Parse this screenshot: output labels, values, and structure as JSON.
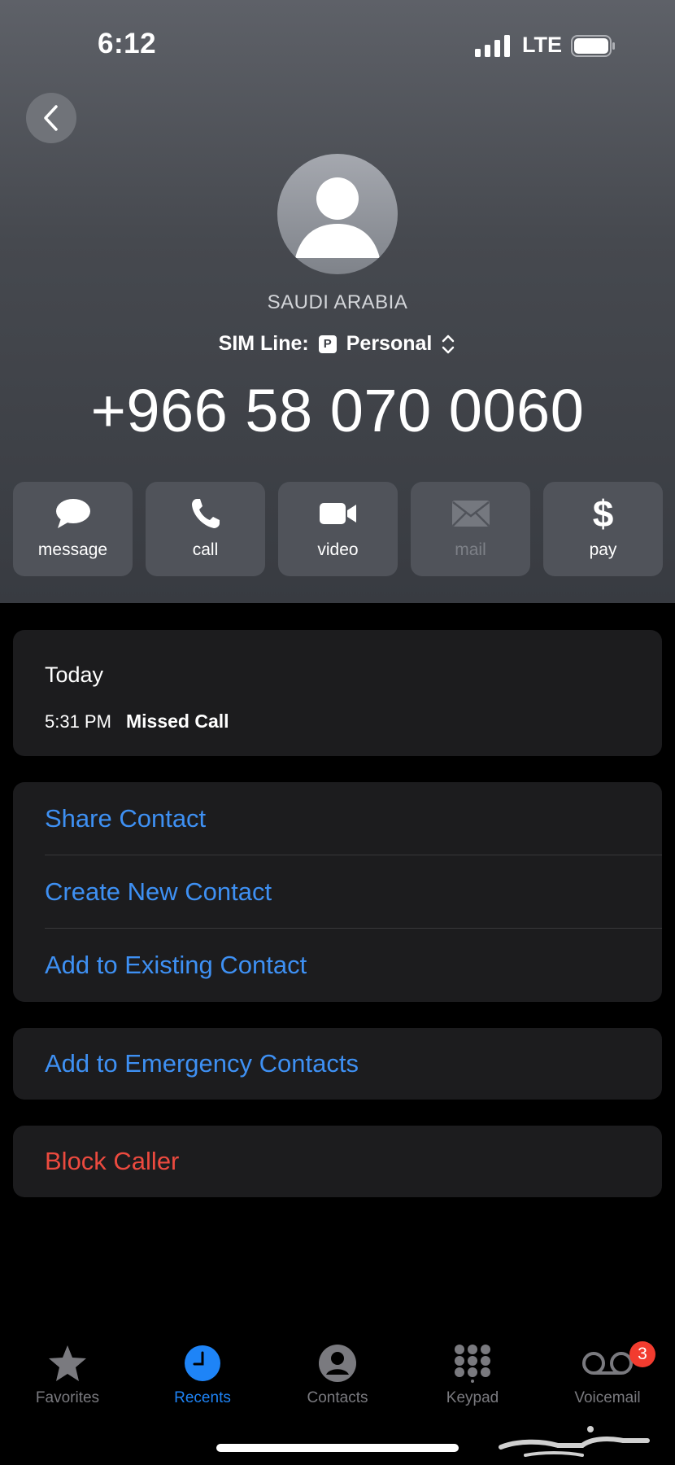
{
  "status_bar": {
    "time": "6:12",
    "network": "LTE"
  },
  "contact": {
    "name": "SAUDI ARABIA",
    "sim_line_label": "SIM Line:",
    "sim_badge": "P",
    "sim_line_value": "Personal",
    "phone_number": "+966 58 070 0060"
  },
  "actions": [
    {
      "label": "message",
      "icon": "message-bubble-icon"
    },
    {
      "label": "call",
      "icon": "phone-icon"
    },
    {
      "label": "video",
      "icon": "video-camera-icon"
    },
    {
      "label": "mail",
      "icon": "envelope-icon",
      "disabled": true
    },
    {
      "label": "pay",
      "icon": "dollar-icon"
    }
  ],
  "recents": {
    "day": "Today",
    "time": "5:31 PM",
    "type": "Missed Call"
  },
  "contact_options": [
    "Share Contact",
    "Create New Contact",
    "Add to Existing Contact"
  ],
  "emergency_option": "Add to Emergency Contacts",
  "block_option": "Block Caller",
  "tabs": [
    {
      "label": "Favorites",
      "icon": "star-icon"
    },
    {
      "label": "Recents",
      "icon": "clock-icon",
      "active": true
    },
    {
      "label": "Contacts",
      "icon": "person-circle-icon"
    },
    {
      "label": "Keypad",
      "icon": "keypad-icon"
    },
    {
      "label": "Voicemail",
      "icon": "voicemail-icon",
      "badge": "3"
    }
  ],
  "colors": {
    "accent": "#3e90f3",
    "destructive": "#ec4a3f",
    "tab_active": "#1e84f7",
    "badge": "#f23c2f"
  },
  "watermark": "حراج"
}
